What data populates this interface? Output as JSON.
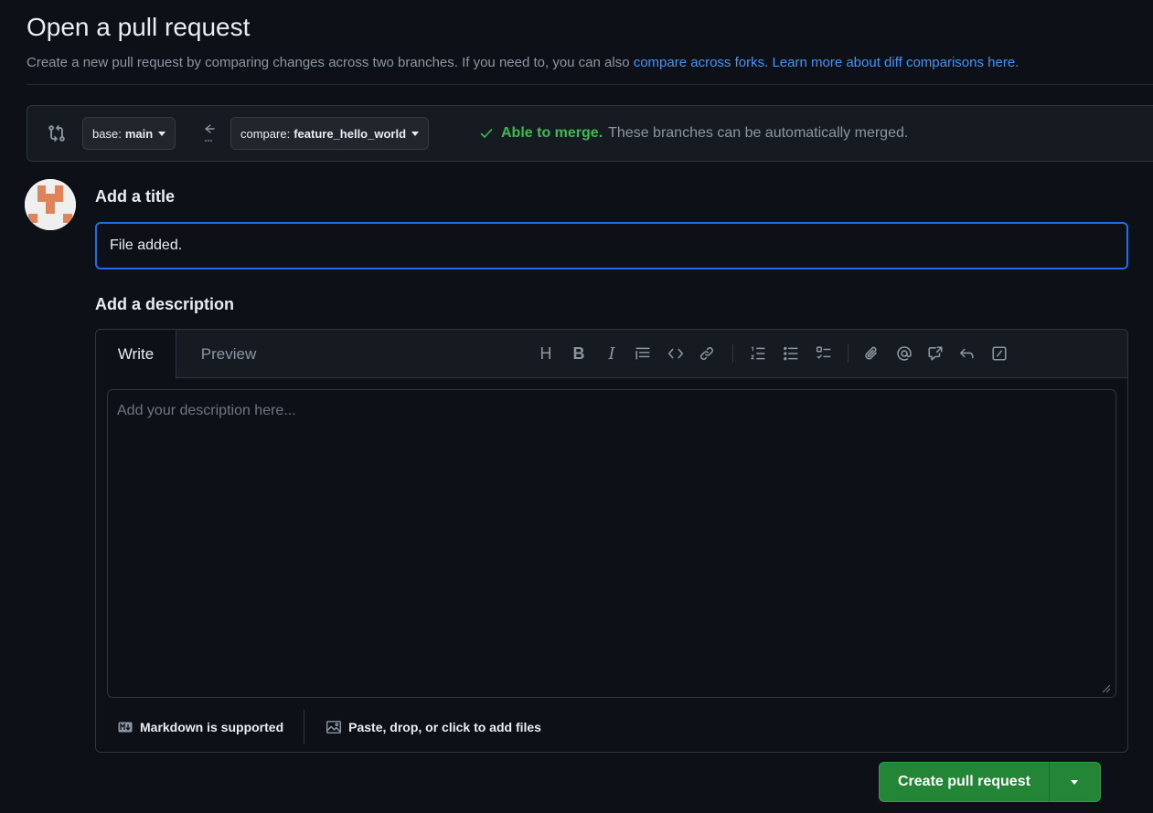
{
  "header": {
    "title": "Open a pull request",
    "subtitle_text": "Create a new pull request by comparing changes across two branches. If you need to, you can also ",
    "link_compare_forks": "compare across forks",
    "subtitle_sep": ". ",
    "link_learn_more": "Learn more about diff comparisons here."
  },
  "range": {
    "base_prefix": "base:",
    "base_branch": "main",
    "compare_prefix": "compare:",
    "compare_branch": "feature_hello_world",
    "merge_ok": "Able to merge.",
    "merge_text": "These branches can be automatically merged."
  },
  "form": {
    "title_label": "Add a title",
    "title_value": "File added.",
    "description_label": "Add a description",
    "tab_write": "Write",
    "tab_preview": "Preview",
    "description_placeholder": "Add your description here...",
    "markdown_note": "Markdown is supported",
    "attach_note": "Paste, drop, or click to add files"
  },
  "toolbar": {
    "heading": "H",
    "bold": "B",
    "italic": "I"
  },
  "actions": {
    "create_label": "Create pull request"
  },
  "colors": {
    "background": "#0d1117",
    "link": "#4493f8",
    "success": "#3fb950",
    "button_green": "#238636",
    "focus_border": "#1f6feb"
  }
}
